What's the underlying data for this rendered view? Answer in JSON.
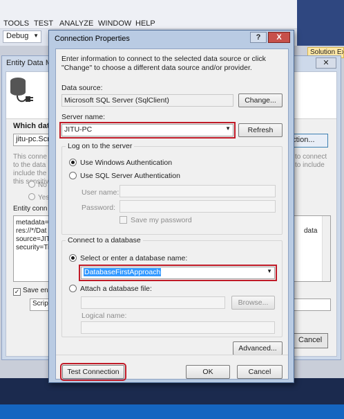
{
  "vs": {
    "menu": [
      "TOOLS",
      "TEST",
      "ANALYZE",
      "WINDOW",
      "HELP"
    ],
    "toolbar_config": "Debug",
    "solution_explorer_tab": "Solution Exp"
  },
  "edm_wizard": {
    "title": "Entity Data Mo",
    "which_connection": "Which data",
    "connection_combo": "jitu-pc.Script",
    "new_connection_button": "ection...",
    "help_text_left": [
      "This conne",
      "to the data",
      "include the",
      "this sensitiv"
    ],
    "help_text_right": [
      "to connect",
      "to include"
    ],
    "radio_no": "No",
    "radio_yes": "Yes",
    "entity_connection_label": "Entity conn",
    "connection_string_left": [
      "metadata=",
      "res://*/Dat",
      "source=JIT",
      "security=Ti"
    ],
    "connection_string_right": "data",
    "save_entity_label": "Save ent",
    "save_entity_checked": true,
    "script_combo": "Script",
    "cancel_button": "Cancel"
  },
  "dialog": {
    "title": "Connection Properties",
    "help_button": "?",
    "close_button": "X",
    "intro": "Enter information to connect to the selected data source or click \"Change\" to choose a different data source and/or provider.",
    "data_source_label": "Data source:",
    "data_source_value": "Microsoft SQL Server (SqlClient)",
    "change_button": "Change...",
    "server_name_label": "Server name:",
    "server_name_value": "JITU-PC",
    "refresh_button": "Refresh",
    "logon_group_title": "Log on to the server",
    "windows_auth_label": "Use Windows Authentication",
    "sql_auth_label": "Use SQL Server Authentication",
    "auth_selected": "windows",
    "user_name_label": "User name:",
    "password_label": "Password:",
    "save_password_label": "Save my password",
    "database_group_title": "Connect to a database",
    "select_db_label": "Select or enter a database name:",
    "database_name_value": "DatabaseFirstApproach",
    "attach_db_label": "Attach a database file:",
    "browse_button": "Browse...",
    "logical_name_label": "Logical name:",
    "advanced_button": "Advanced...",
    "test_connection_button": "Test Connection",
    "ok_button": "OK",
    "cancel_button": "Cancel"
  }
}
